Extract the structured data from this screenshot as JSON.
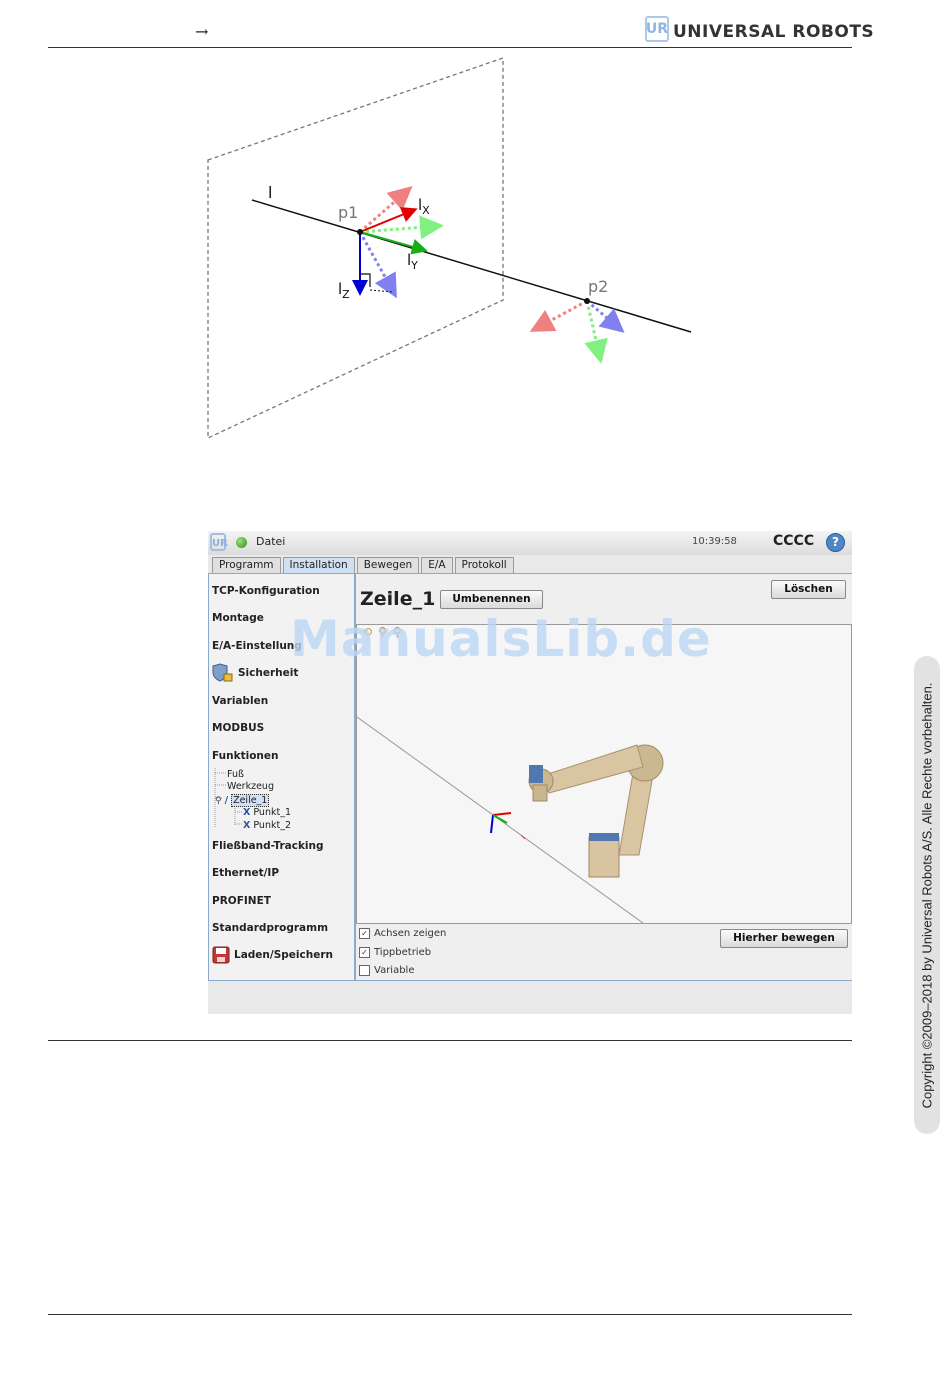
{
  "header": {
    "arrow": "→",
    "brand_name": "UNIVERSAL ROBOTS",
    "brand_logo": "UR"
  },
  "copyright": "Copyright ©2009–2018 by Universal Robots A/S. Alle Rechte vorbehalten.",
  "watermark": "ManualsLib.de",
  "diagram": {
    "line_label": "l",
    "p1_label": "p1",
    "p2_label": "p2",
    "lx_label": "l",
    "lx_sub": "X",
    "ly_label": "l",
    "ly_sub": "Y",
    "lz_label": "l",
    "lz_sub": "Z",
    "colors": {
      "x_axis": "#e00000",
      "y_axis": "#16b016",
      "z_axis": "#0000d0"
    }
  },
  "ui": {
    "topbar": {
      "logo": "UR",
      "file_menu": "Datei",
      "time": "10:39:58",
      "robot_name": "CCCC",
      "help": "?"
    },
    "tabs": [
      "Programm",
      "Installation",
      "Bewegen",
      "E/A",
      "Protokoll"
    ],
    "sidebar": {
      "items": [
        "TCP-Konfiguration",
        "Montage",
        "E/A-Einstellung",
        "Sicherheit",
        "Variablen",
        "MODBUS",
        "Funktionen",
        "Fließband-Tracking",
        "Ethernet/IP",
        "PROFINET",
        "Standardprogramm",
        "Laden/Speichern"
      ],
      "tree": {
        "base": "Fuß",
        "tool": "Werkzeug",
        "line": "Zeile_1",
        "point1": "Punkt_1",
        "point2": "Punkt_2"
      }
    },
    "main": {
      "feature_title": "Zeile_1",
      "rename_button": "Umbenennen",
      "delete_button": "Löschen",
      "checkboxes": [
        {
          "label": "Achsen zeigen",
          "checked": true
        },
        {
          "label": "Tippbetrieb",
          "checked": true
        },
        {
          "label": "Variable",
          "checked": false
        }
      ],
      "move_here_button": "Hierher bewegen"
    }
  }
}
